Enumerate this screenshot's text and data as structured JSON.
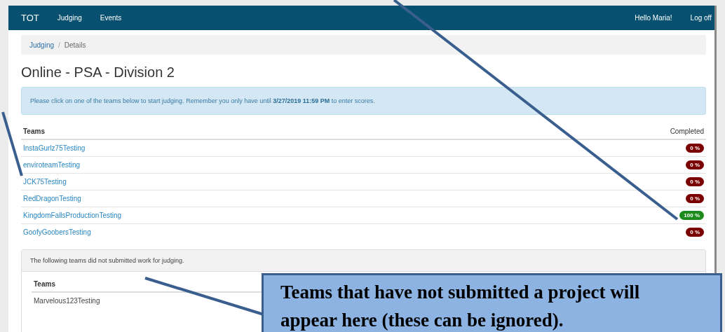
{
  "navbar": {
    "brand": "TOT",
    "links": [
      "Judging",
      "Events"
    ],
    "greeting": "Hello Maria!",
    "logoff": "Log off"
  },
  "breadcrumb": {
    "items": [
      "Judging",
      "Details"
    ],
    "separator": "/"
  },
  "title": "Online - PSA - Division 2",
  "alert": "Please click on one of the teams below to start judging. Remember you only have until **3/27/2019 11:59 PM** to enter scores.",
  "table": {
    "columns": [
      "Teams",
      "Completed"
    ],
    "rows": [
      {
        "team": "InstaGurlz75Testing",
        "completed": "0 %",
        "color": "#7b0000"
      },
      {
        "team": "enviroteamTesting",
        "completed": "0 %",
        "color": "#7b0000"
      },
      {
        "team": "JCK75Testing",
        "completed": "0 %",
        "color": "#7b0000"
      },
      {
        "team": "RedDragonTesting",
        "completed": "0 %",
        "color": "#7b0000"
      },
      {
        "team": "KingdomFallsProductionTesting",
        "completed": "100 %",
        "color": "#1c8a1c"
      },
      {
        "team": "GoofyGoobersTesting",
        "completed": "0 %",
        "color": "#7b0000"
      }
    ]
  },
  "not_submitted_panel": {
    "heading": "The following teams did not submitted work for judging.",
    "columns": [
      "Teams"
    ],
    "rows": [
      "Marvelous123Testing"
    ]
  },
  "callout": {
    "text": "Teams that have not submitted a project will appear here (these can be ignored)."
  }
}
